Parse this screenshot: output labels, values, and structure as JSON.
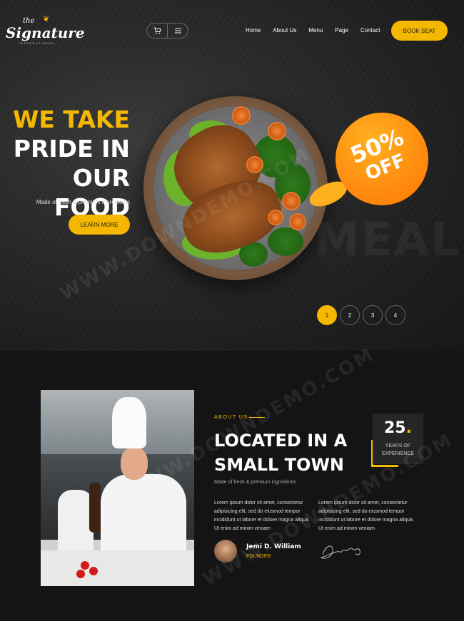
{
  "brand": {
    "the": "the",
    "name": "Signature",
    "tagline": "INTERNATIONAL"
  },
  "header": {
    "cart_icon": "cart-icon",
    "menu_icon": "hamburger-icon",
    "nav": [
      "Home",
      "About Us",
      "Menu",
      "Page",
      "Contact"
    ],
    "book_label": "BOOK SEAT"
  },
  "hero": {
    "line1": "WE TAKE",
    "line2": "PRIDE IN",
    "line3": "OUR FOOD",
    "subtitle": "Made of fresh & premium ingredients",
    "cta_label": "LEARN MORE",
    "badge_pct": "50%",
    "badge_off": "OFF",
    "pages": [
      "1",
      "2",
      "3",
      "4"
    ],
    "active_page": "1"
  },
  "about": {
    "label": "ABOUT US",
    "title_line1": "LOCATED IN A",
    "title_line2": "SMALL TOWN",
    "subtitle": "Made of fresh & premium ingredients",
    "years_number": "25",
    "years_dot": ".",
    "years_label_1": "YEARS OF",
    "years_label_2": "EXPERIENCE",
    "paragraph_1": "Lorem ipsum dolor sit amet, consectetur adipisicing elit, sed do eiusmod tempor incididunt ut labore et dolore magna aliqua. Ut enim ad minim veniam",
    "paragraph_2": "Lorem ipsum dolor sit amet, consectetur adipisicing elit, sed do eiusmod tempor incididunt ut labore et dolore magna aliqua. Ut enim ad minim veniam",
    "author_name": "Jemi D. William",
    "author_role": "FOUNDER"
  },
  "watermark": "WWW.DOWNDEMO.COM",
  "colors": {
    "accent": "#f5b800",
    "badge": "#ff8c0f",
    "background": "#141414"
  }
}
